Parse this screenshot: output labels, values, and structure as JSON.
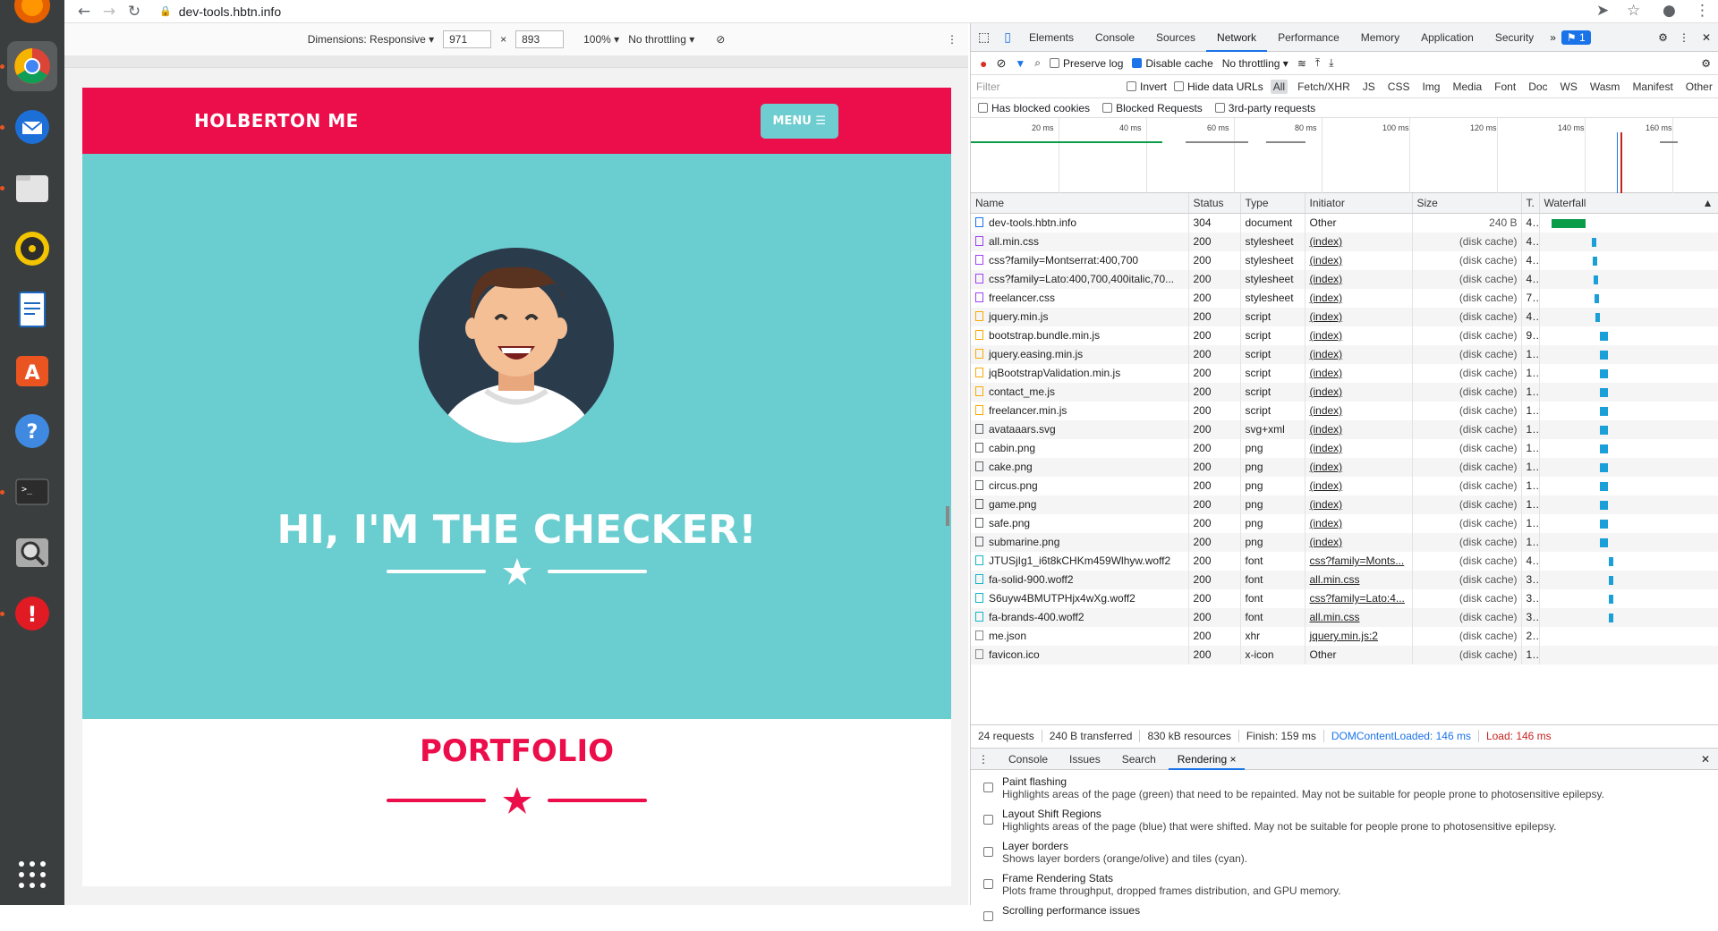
{
  "browser": {
    "url": "dev-tools.hbtn.info",
    "device_toolbar": {
      "dimensions_label": "Dimensions: Responsive",
      "width": "971",
      "times": "×",
      "height": "893",
      "zoom": "100%",
      "throttling": "No throttling"
    }
  },
  "site": {
    "brand": "HOLBERTON ME",
    "menu_label": "MENU",
    "hero_title": "HI, I'M THE CHECKER!",
    "portfolio_title": "PORTFOLIO"
  },
  "devtools": {
    "tabs": [
      "Elements",
      "Console",
      "Sources",
      "Network",
      "Performance",
      "Memory",
      "Application",
      "Security"
    ],
    "selected_tab": "Network",
    "issues_badge": "1",
    "toolbar": {
      "preserve_log": "Preserve log",
      "disable_cache": "Disable cache",
      "throttling": "No throttling"
    },
    "filter": {
      "placeholder": "Filter",
      "invert": "Invert",
      "hide_data_urls": "Hide data URLs",
      "types": [
        "All",
        "Fetch/XHR",
        "JS",
        "CSS",
        "Img",
        "Media",
        "Font",
        "Doc",
        "WS",
        "Wasm",
        "Manifest",
        "Other"
      ],
      "has_blocked_cookies": "Has blocked cookies",
      "blocked_requests": "Blocked Requests",
      "third_party": "3rd-party requests"
    },
    "overview_ticks": [
      "20 ms",
      "40 ms",
      "60 ms",
      "80 ms",
      "100 ms",
      "120 ms",
      "140 ms",
      "160 ms"
    ],
    "columns": [
      "Name",
      "Status",
      "Type",
      "Initiator",
      "Size",
      "T.",
      "Waterfall"
    ],
    "requests": [
      {
        "name": "dev-tools.hbtn.info",
        "status": "304",
        "type": "document",
        "initiator": "Other",
        "size": "240 B",
        "time": "4...",
        "icon": "doc",
        "link": false
      },
      {
        "name": "all.min.css",
        "status": "200",
        "type": "stylesheet",
        "initiator": "(index)",
        "size": "(disk cache)",
        "time": "4...",
        "icon": "css",
        "link": true
      },
      {
        "name": "css?family=Montserrat:400,700",
        "status": "200",
        "type": "stylesheet",
        "initiator": "(index)",
        "size": "(disk cache)",
        "time": "4...",
        "icon": "css",
        "link": true
      },
      {
        "name": "css?family=Lato:400,700,400italic,70...",
        "status": "200",
        "type": "stylesheet",
        "initiator": "(index)",
        "size": "(disk cache)",
        "time": "4...",
        "icon": "css",
        "link": true
      },
      {
        "name": "freelancer.css",
        "status": "200",
        "type": "stylesheet",
        "initiator": "(index)",
        "size": "(disk cache)",
        "time": "7...",
        "icon": "css",
        "link": true
      },
      {
        "name": "jquery.min.js",
        "status": "200",
        "type": "script",
        "initiator": "(index)",
        "size": "(disk cache)",
        "time": "4...",
        "icon": "js",
        "link": true
      },
      {
        "name": "bootstrap.bundle.min.js",
        "status": "200",
        "type": "script",
        "initiator": "(index)",
        "size": "(disk cache)",
        "time": "9...",
        "icon": "js",
        "link": true
      },
      {
        "name": "jquery.easing.min.js",
        "status": "200",
        "type": "script",
        "initiator": "(index)",
        "size": "(disk cache)",
        "time": "1...",
        "icon": "js",
        "link": true
      },
      {
        "name": "jqBootstrapValidation.min.js",
        "status": "200",
        "type": "script",
        "initiator": "(index)",
        "size": "(disk cache)",
        "time": "1...",
        "icon": "js",
        "link": true
      },
      {
        "name": "contact_me.js",
        "status": "200",
        "type": "script",
        "initiator": "(index)",
        "size": "(disk cache)",
        "time": "1...",
        "icon": "js",
        "link": true
      },
      {
        "name": "freelancer.min.js",
        "status": "200",
        "type": "script",
        "initiator": "(index)",
        "size": "(disk cache)",
        "time": "1...",
        "icon": "js",
        "link": true
      },
      {
        "name": "avataaars.svg",
        "status": "200",
        "type": "svg+xml",
        "initiator": "(index)",
        "size": "(disk cache)",
        "time": "1...",
        "icon": "img",
        "link": true
      },
      {
        "name": "cabin.png",
        "status": "200",
        "type": "png",
        "initiator": "(index)",
        "size": "(disk cache)",
        "time": "1...",
        "icon": "img",
        "link": true
      },
      {
        "name": "cake.png",
        "status": "200",
        "type": "png",
        "initiator": "(index)",
        "size": "(disk cache)",
        "time": "1...",
        "icon": "img",
        "link": true
      },
      {
        "name": "circus.png",
        "status": "200",
        "type": "png",
        "initiator": "(index)",
        "size": "(disk cache)",
        "time": "1...",
        "icon": "img",
        "link": true
      },
      {
        "name": "game.png",
        "status": "200",
        "type": "png",
        "initiator": "(index)",
        "size": "(disk cache)",
        "time": "1...",
        "icon": "img",
        "link": true
      },
      {
        "name": "safe.png",
        "status": "200",
        "type": "png",
        "initiator": "(index)",
        "size": "(disk cache)",
        "time": "1...",
        "icon": "img",
        "link": true
      },
      {
        "name": "submarine.png",
        "status": "200",
        "type": "png",
        "initiator": "(index)",
        "size": "(disk cache)",
        "time": "1...",
        "icon": "img",
        "link": true
      },
      {
        "name": "JTUSjIg1_i6t8kCHKm459Wlhyw.woff2",
        "status": "200",
        "type": "font",
        "initiator": "css?family=Monts...",
        "size": "(disk cache)",
        "time": "4...",
        "icon": "font",
        "link": true
      },
      {
        "name": "fa-solid-900.woff2",
        "status": "200",
        "type": "font",
        "initiator": "all.min.css",
        "size": "(disk cache)",
        "time": "3...",
        "icon": "font",
        "link": true
      },
      {
        "name": "S6uyw4BMUTPHjx4wXg.woff2",
        "status": "200",
        "type": "font",
        "initiator": "css?family=Lato:4...",
        "size": "(disk cache)",
        "time": "3...",
        "icon": "font",
        "link": true
      },
      {
        "name": "fa-brands-400.woff2",
        "status": "200",
        "type": "font",
        "initiator": "all.min.css",
        "size": "(disk cache)",
        "time": "3...",
        "icon": "font",
        "link": true
      },
      {
        "name": "me.json",
        "status": "200",
        "type": "xhr",
        "initiator": "jquery.min.js:2",
        "size": "(disk cache)",
        "time": "2...",
        "icon": "other",
        "link": true
      },
      {
        "name": "favicon.ico",
        "status": "200",
        "type": "x-icon",
        "initiator": "Other",
        "size": "(disk cache)",
        "time": "1...",
        "icon": "other",
        "link": false
      }
    ],
    "summary": {
      "requests": "24 requests",
      "transferred": "240 B transferred",
      "resources": "830 kB resources",
      "finish": "Finish: 159 ms",
      "dcl": "DOMContentLoaded: 146 ms",
      "load": "Load: 146 ms"
    },
    "drawer": {
      "tabs": [
        "Console",
        "Issues",
        "Search",
        "Rendering"
      ],
      "selected": "Rendering",
      "options": [
        {
          "title": "Paint flashing",
          "desc": "Highlights areas of the page (green) that need to be repainted. May not be suitable for people prone to photosensitive epilepsy."
        },
        {
          "title": "Layout Shift Regions",
          "desc": "Highlights areas of the page (blue) that were shifted. May not be suitable for people prone to photosensitive epilepsy."
        },
        {
          "title": "Layer borders",
          "desc": "Shows layer borders (orange/olive) and tiles (cyan)."
        },
        {
          "title": "Frame Rendering Stats",
          "desc": "Plots frame throughput, dropped frames distribution, and GPU memory."
        },
        {
          "title": "Scrolling performance issues",
          "desc": ""
        }
      ]
    }
  },
  "colors": {
    "brand_red": "#eb0e4b",
    "hero_teal": "#6acdd0",
    "devtools_blue": "#1a73e8"
  },
  "dock_icons": [
    "firefox-icon",
    "chrome-icon",
    "thunderbird-icon",
    "files-icon",
    "rhythmbox-icon",
    "writer-icon",
    "software-icon",
    "help-icon",
    "terminal-icon",
    "magnifier-icon",
    "update-icon",
    "app-grid-icon"
  ]
}
